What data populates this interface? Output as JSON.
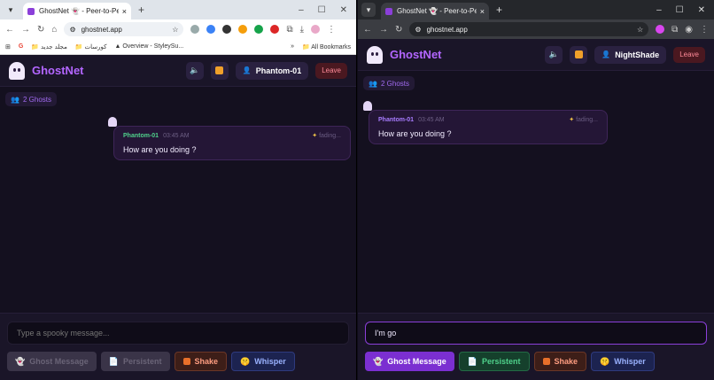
{
  "left": {
    "tab_title": "GhostNet 👻 - Peer-to-Peer Gh",
    "url": "ghostnet.app",
    "bookmarks": [
      "مجلد جديد",
      "كورسات",
      "Overview - StyleySu...",
      "All Bookmarks"
    ],
    "brand": "GhostNet",
    "username": "Phantom-01",
    "leave": "Leave",
    "ghost_count": "2 Ghosts",
    "message": {
      "sender": "Phantom-01",
      "time": "03:45 AM",
      "status": "fading...",
      "text": "How are you doing ?"
    },
    "input_placeholder": "Type a spooky message...",
    "input_value": "",
    "buttons": {
      "ghost": "Ghost Message",
      "persistent": "Persistent",
      "shake": "Shake",
      "whisper": "Whisper"
    }
  },
  "right": {
    "tab_title": "GhostNet 👻 - Peer-to-Peer Gh",
    "url": "ghostnet.app",
    "brand": "GhostNet",
    "username": "NightShade",
    "leave": "Leave",
    "ghost_count": "2 Ghosts",
    "message": {
      "sender": "Phantom-01",
      "time": "03:45 AM",
      "status": "fading...",
      "text": "How are you doing ?"
    },
    "input_value": "I'm go",
    "buttons": {
      "ghost": "Ghost Message",
      "persistent": "Persistent",
      "shake": "Shake",
      "whisper": "Whisper"
    }
  },
  "colors": {
    "accent": "#b366ff",
    "sender_left": "#4fd18b",
    "sender_right": "#a87cff"
  }
}
